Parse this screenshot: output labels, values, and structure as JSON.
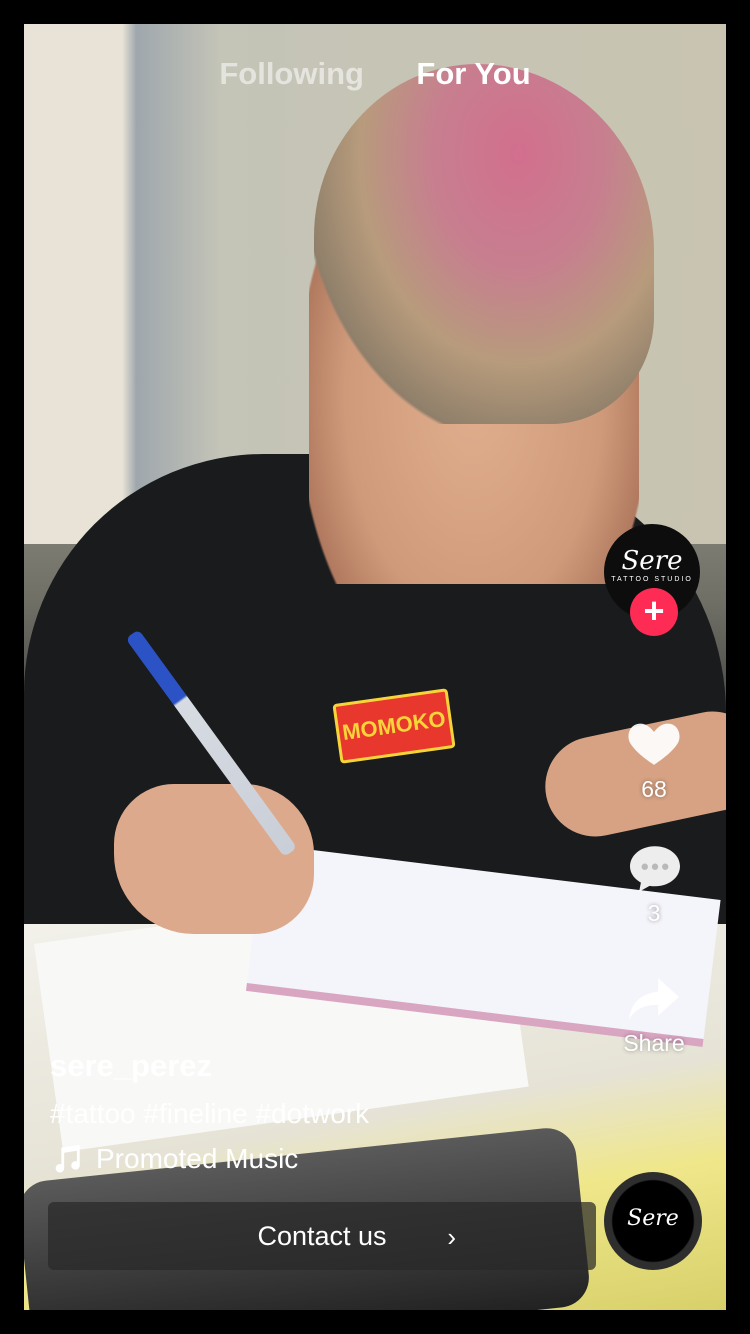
{
  "feed_tabs": [
    {
      "label": "Following",
      "active": false
    },
    {
      "label": "For You",
      "active": true
    }
  ],
  "profile": {
    "logo_text": "Sere",
    "logo_subtext": "TATTOO STUDIO",
    "follow_symbol": "+"
  },
  "actions": {
    "likes": "68",
    "comments": "3",
    "share_label": "Share"
  },
  "post": {
    "username": "sere_perez",
    "caption": "#tattoo #fineline #dotwork",
    "music": "Promoted Music"
  },
  "cta": {
    "label": "Contact us",
    "chevron": "›"
  },
  "sticker_text": "MOMOKO",
  "disc_text": "Sere",
  "colors": {
    "follow_button": "#fe2c55",
    "text": "#ffffff",
    "cta_background": "rgba(40,40,40,0.72)"
  }
}
